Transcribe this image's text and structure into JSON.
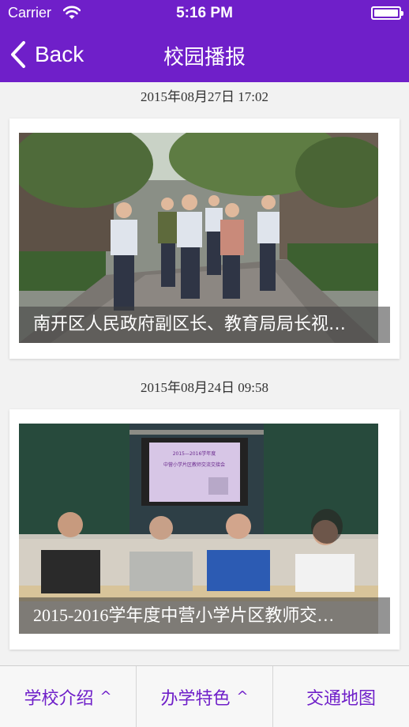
{
  "status_bar": {
    "carrier": "Carrier",
    "time": "5:16 PM"
  },
  "nav": {
    "back_label": "Back",
    "title": "校园播报"
  },
  "news": [
    {
      "date": "2015年08月27日 17:02",
      "caption": "南开区人民政府副区长、教育局局长视…"
    },
    {
      "date": "2015年08月24日 09:58",
      "caption": "2015-2016学年度中营小学片区教师交…",
      "slide_title": "2015—2016学年度",
      "slide_subtitle": "中营小学片区教师交流交接会"
    }
  ],
  "tabs": [
    {
      "label": "学校介绍",
      "caret": "^"
    },
    {
      "label": "办学特色",
      "caret": "^"
    },
    {
      "label": "交通地图",
      "caret": ""
    }
  ],
  "colors": {
    "accent": "#6f1fc9"
  }
}
